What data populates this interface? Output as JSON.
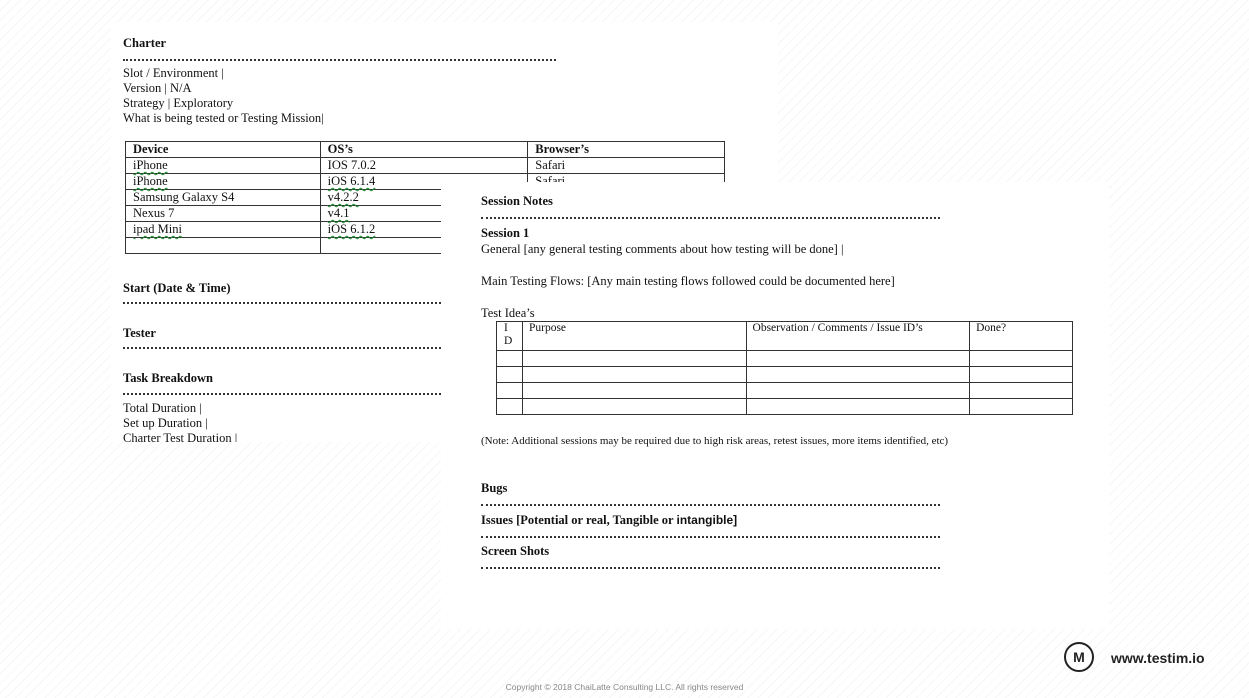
{
  "charter": {
    "heading": "Charter",
    "lines": [
      "Slot / Environment |",
      "Version | N/A",
      "Strategy | Exploratory",
      "What is being tested or Testing Mission|"
    ],
    "device_table": {
      "headers": [
        "Device",
        "OS’s",
        "Browser’s"
      ],
      "rows": [
        [
          "iPhone",
          "IOS 7.0.2",
          "Safari"
        ],
        [
          "iPhone",
          "iOS 6.1.4",
          "Safari"
        ],
        [
          "Samsung Galaxy S4",
          "v4.2.2",
          ""
        ],
        [
          "Nexus 7",
          "v4.1",
          ""
        ],
        [
          "ipad Mini",
          "iOS 6.1.2",
          ""
        ],
        [
          "",
          "",
          ""
        ]
      ]
    },
    "start_heading": "Start (Date & Time)",
    "tester_heading": "Tester",
    "task_heading": "Task Breakdown",
    "task_lines": [
      "Total Duration |",
      "Set up Duration |",
      "Charter Test Duration |"
    ]
  },
  "session": {
    "notes_heading": "Session Notes",
    "session_title": "Session 1",
    "general": "General [any general testing comments about how testing will be done] |",
    "main_flows": "Main Testing Flows: [Any main testing flows followed could be documented here]",
    "test_ideas_label": "Test Idea’s",
    "ideas_table": {
      "headers": [
        "I D",
        "Purpose",
        "Observation / Comments / Issue ID’s",
        "Done?"
      ],
      "empty_rows": 4
    },
    "note": "(Note:  Additional sessions may be required due to high risk areas, retest issues, more items identified, etc)",
    "bugs_heading": "Bugs",
    "issues_heading_part1": "Issues [Potential or real, Tangible or ",
    "issues_heading_part2": "intangible]",
    "screenshots_heading": "Screen Shots"
  },
  "branding": {
    "logo_letter": "M",
    "site": "www.testim.io",
    "copyright": "Copyright © 2018 ChaiLatte Consulting LLC. All rights reserved"
  }
}
